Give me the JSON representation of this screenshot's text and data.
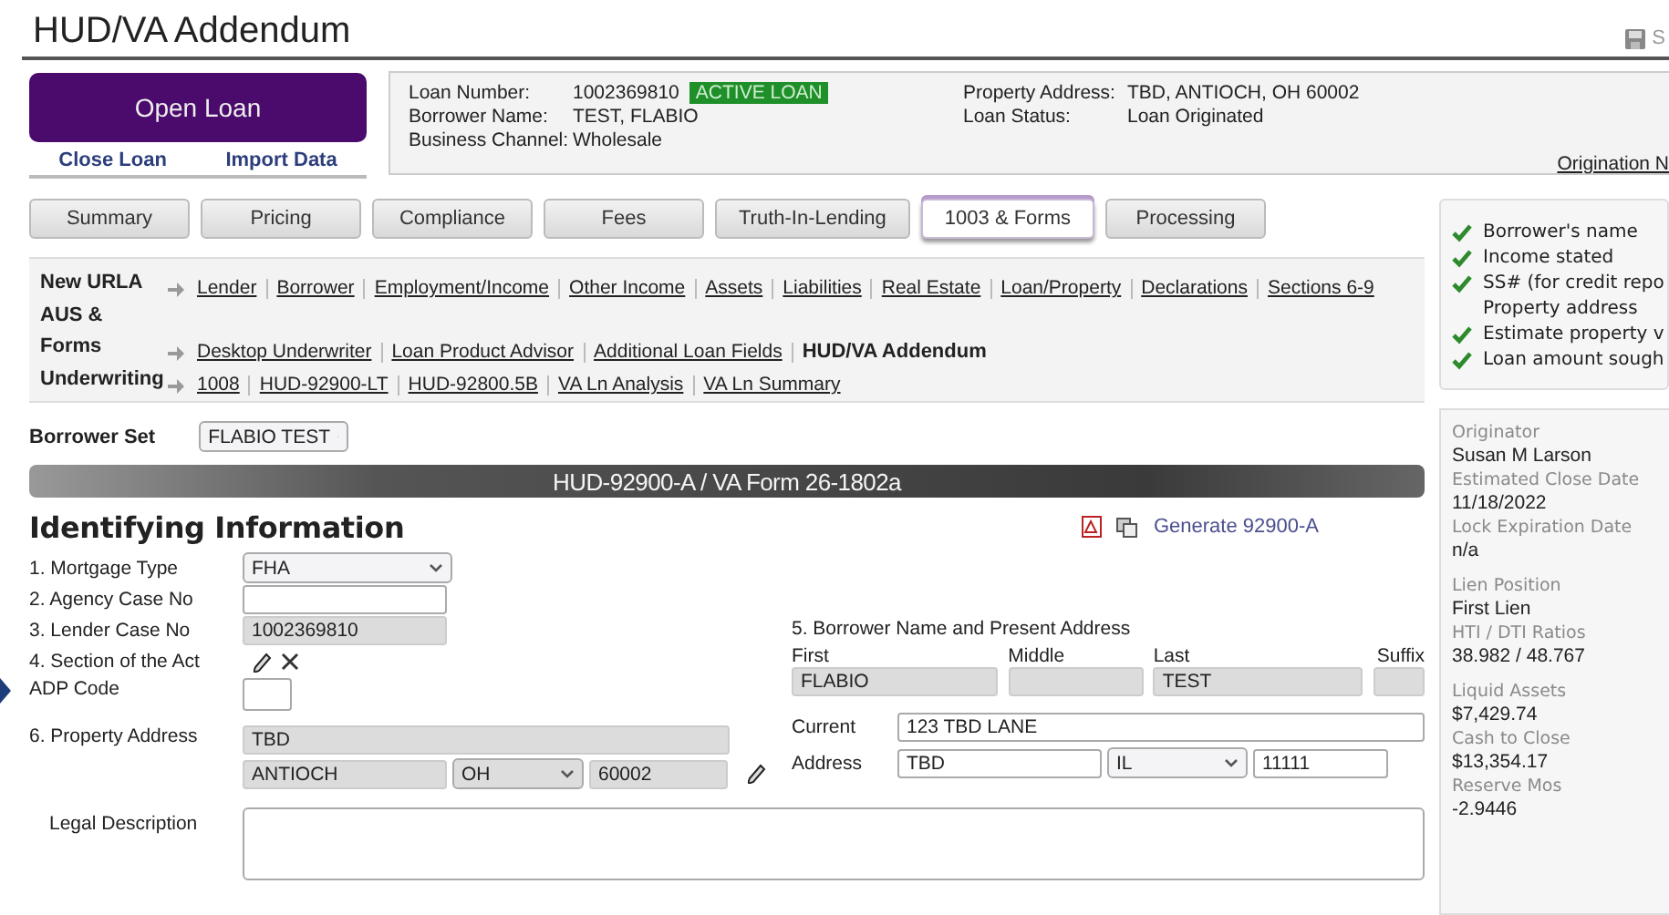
{
  "page_title": "HUD/VA Addendum",
  "save_label": "S",
  "loan_actions": {
    "open": "Open Loan",
    "links": [
      "Close Loan",
      "Import Data"
    ]
  },
  "loan_info": {
    "left": [
      {
        "label": "Loan Number:",
        "value": "1002369810",
        "badge": "ACTIVE LOAN"
      },
      {
        "label": "Borrower Name:",
        "value": "TEST, FLABIO"
      },
      {
        "label": "Business Channel:",
        "value": "Wholesale"
      }
    ],
    "right": [
      {
        "label": "Property Address:",
        "value": "TBD, ANTIOCH, OH 60002"
      },
      {
        "label": "Loan Status:",
        "value": "Loan Originated"
      }
    ],
    "link": "Origination N"
  },
  "tabs": [
    {
      "label": "Summary",
      "selected": false
    },
    {
      "label": "Pricing",
      "selected": false
    },
    {
      "label": "Compliance",
      "selected": false
    },
    {
      "label": "Fees",
      "selected": false
    },
    {
      "label": "Truth-In-Lending",
      "selected": false
    },
    {
      "label": "1003 & Forms",
      "selected": true
    },
    {
      "label": "Processing",
      "selected": false
    }
  ],
  "nav": [
    {
      "heading": "New URLA",
      "links": [
        {
          "label": "Lender",
          "current": false
        },
        {
          "label": "Borrower",
          "current": false
        },
        {
          "label": "Employment/Income",
          "current": false
        },
        {
          "label": "Other Income",
          "current": false
        },
        {
          "label": "Assets",
          "current": false
        },
        {
          "label": "Liabilities",
          "current": false
        },
        {
          "label": "Real Estate",
          "current": false
        },
        {
          "label": "Loan/Property",
          "current": false
        },
        {
          "label": "Declarations",
          "current": false
        },
        {
          "label": "Sections 6-9",
          "current": false
        }
      ]
    },
    {
      "heading": "AUS & Forms",
      "links": [
        {
          "label": "Desktop Underwriter",
          "current": false
        },
        {
          "label": "Loan Product Advisor",
          "current": false
        },
        {
          "label": "Additional Loan Fields",
          "current": false
        },
        {
          "label": "HUD/VA Addendum",
          "current": true
        }
      ]
    },
    {
      "heading": "Underwriting",
      "links": [
        {
          "label": "1008",
          "current": false
        },
        {
          "label": "HUD-92900-LT",
          "current": false
        },
        {
          "label": "HUD-92800.5B",
          "current": false
        },
        {
          "label": "VA Ln Analysis",
          "current": false
        },
        {
          "label": "VA Ln Summary",
          "current": false
        }
      ]
    }
  ],
  "borrower_set": {
    "label": "Borrower Set",
    "value": "FLABIO TEST"
  },
  "form_banner": "HUD-92900-A / VA Form 26-1802a",
  "section_title": "Identifying Information",
  "generate_link": "Generate 92900-A",
  "fields": [
    {
      "label": "1. Mortgage Type",
      "kind": "select",
      "value": "FHA"
    },
    {
      "label": "2. Agency Case No",
      "kind": "text"
    },
    {
      "label": "3. Lender Case No",
      "kind": "readonly",
      "value": "1002369810"
    },
    {
      "label": "4. Section of the Act",
      "kind": "icons"
    },
    {
      "label": "ADP Code",
      "kind": "small"
    }
  ],
  "property": {
    "label": "6. Property Address",
    "street": "TBD",
    "city": "ANTIOCH",
    "state": "OH",
    "zip": "60002"
  },
  "borrower_block": {
    "heading": "5. Borrower Name and Present Address",
    "name_parts": [
      {
        "label": "First",
        "value": "FLABIO"
      },
      {
        "label": "Middle"
      },
      {
        "label": "Last",
        "value": "TEST"
      },
      {
        "label": "Suffix"
      }
    ],
    "address_labels": [
      "Current",
      "Address"
    ],
    "street": "123 TBD LANE",
    "city": "TBD",
    "state": "IL",
    "zip": "11111"
  },
  "legal_description": {
    "label": "Legal Description"
  },
  "checklist": [
    {
      "label": "Borrower's name",
      "checked": true
    },
    {
      "label": "Income stated",
      "checked": true
    },
    {
      "label": "SS# (for credit repo",
      "checked": true
    },
    {
      "label": "Property address",
      "checked": false
    },
    {
      "label": "Estimate property v",
      "checked": true
    },
    {
      "label": "Loan amount sough",
      "checked": true
    }
  ],
  "summary": [
    [
      {
        "label": "Originator",
        "value": "Susan M Larson"
      },
      {
        "label": "Estimated Close Date",
        "value": "11/18/2022"
      },
      {
        "label": "Lock Expiration Date",
        "value": "n/a"
      }
    ],
    [
      {
        "label": "Lien Position",
        "value": "First Lien"
      },
      {
        "label": "HTI / DTI Ratios",
        "value": "38.982 / 48.767"
      }
    ],
    [
      {
        "label": "Liquid Assets",
        "value": "$7,429.74"
      },
      {
        "label": "Cash to Close",
        "value": "$13,354.17"
      },
      {
        "label": "Reserve Mos",
        "value": "-2.9446"
      }
    ]
  ]
}
